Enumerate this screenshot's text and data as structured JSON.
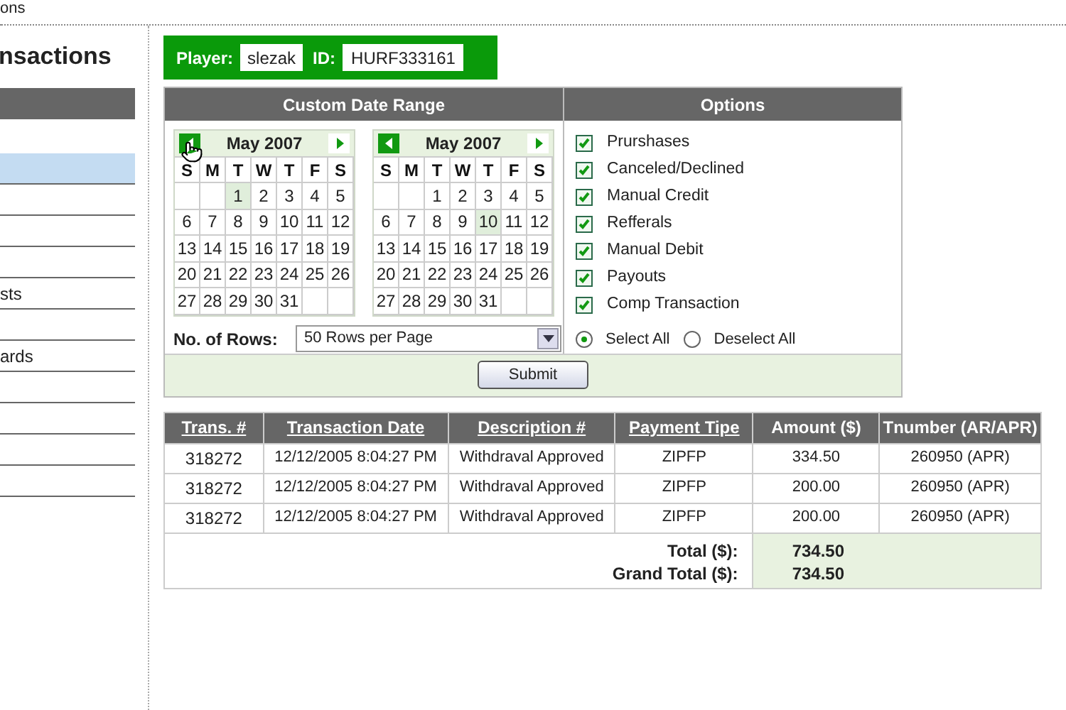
{
  "breadcrumb": "ons",
  "page_title": "nsactions",
  "sidebar": {
    "items": [
      {
        "selected": true
      },
      {
        "selected": false
      },
      {
        "selected": false
      },
      {
        "selected": false
      },
      {
        "selected": false,
        "label": "sts"
      },
      {
        "selected": false
      },
      {
        "selected": false,
        "label": "ards"
      },
      {
        "selected": false
      },
      {
        "selected": false
      },
      {
        "selected": false
      },
      {
        "selected": false
      }
    ]
  },
  "player": {
    "label": "Player:",
    "value": "slezak",
    "id_label": "ID:",
    "id_value": "HURF333161"
  },
  "date_range": {
    "title": "Custom Date Range",
    "calendars": [
      {
        "month": "May 2007",
        "weekdays": [
          "S",
          "M",
          "T",
          "W",
          "T",
          "F",
          "S"
        ],
        "days": [
          {
            "day": "1",
            "selected": true
          },
          {
            "day": "2",
            "selected": false
          },
          {
            "day": "3",
            "selected": false
          },
          {
            "day": "4",
            "selected": false
          },
          {
            "day": "5",
            "selected": false
          },
          {
            "day": "6",
            "selected": false
          },
          {
            "day": "7",
            "selected": false
          },
          {
            "day": "8",
            "selected": false
          },
          {
            "day": "9",
            "selected": false
          },
          {
            "day": "10",
            "selected": false
          },
          {
            "day": "11",
            "selected": false
          },
          {
            "day": "12",
            "selected": false
          },
          {
            "day": "13",
            "selected": false
          },
          {
            "day": "14",
            "selected": false
          },
          {
            "day": "15",
            "selected": false
          },
          {
            "day": "16",
            "selected": false
          },
          {
            "day": "17",
            "selected": false
          },
          {
            "day": "18",
            "selected": false
          },
          {
            "day": "19",
            "selected": false
          },
          {
            "day": "20",
            "selected": false
          },
          {
            "day": "21",
            "selected": false
          },
          {
            "day": "22",
            "selected": false
          },
          {
            "day": "23",
            "selected": false
          },
          {
            "day": "24",
            "selected": false
          },
          {
            "day": "25",
            "selected": false
          },
          {
            "day": "26",
            "selected": false
          },
          {
            "day": "27",
            "selected": false
          },
          {
            "day": "28",
            "selected": false
          },
          {
            "day": "29",
            "selected": false
          },
          {
            "day": "30",
            "selected": false
          },
          {
            "day": "31",
            "selected": false
          }
        ]
      },
      {
        "month": "May 2007",
        "weekdays": [
          "S",
          "M",
          "T",
          "W",
          "T",
          "F",
          "S"
        ],
        "days": [
          {
            "day": "1",
            "selected": false
          },
          {
            "day": "2",
            "selected": false
          },
          {
            "day": "3",
            "selected": false
          },
          {
            "day": "4",
            "selected": false
          },
          {
            "day": "5",
            "selected": false
          },
          {
            "day": "6",
            "selected": false
          },
          {
            "day": "7",
            "selected": false
          },
          {
            "day": "8",
            "selected": false
          },
          {
            "day": "9",
            "selected": false
          },
          {
            "day": "10",
            "selected": true
          },
          {
            "day": "11",
            "selected": false
          },
          {
            "day": "12",
            "selected": false
          },
          {
            "day": "13",
            "selected": false
          },
          {
            "day": "14",
            "selected": false
          },
          {
            "day": "15",
            "selected": false
          },
          {
            "day": "16",
            "selected": false
          },
          {
            "day": "17",
            "selected": false
          },
          {
            "day": "18",
            "selected": false
          },
          {
            "day": "19",
            "selected": false
          },
          {
            "day": "20",
            "selected": false
          },
          {
            "day": "21",
            "selected": false
          },
          {
            "day": "22",
            "selected": false
          },
          {
            "day": "23",
            "selected": false
          },
          {
            "day": "24",
            "selected": false
          },
          {
            "day": "25",
            "selected": false
          },
          {
            "day": "26",
            "selected": false
          },
          {
            "day": "27",
            "selected": false
          },
          {
            "day": "28",
            "selected": false
          },
          {
            "day": "29",
            "selected": false
          },
          {
            "day": "30",
            "selected": false
          },
          {
            "day": "31",
            "selected": false
          }
        ]
      }
    ],
    "rows_label": "No. of Rows:",
    "rows_value": "50 Rows per Page"
  },
  "options": {
    "title": "Options",
    "items": [
      {
        "label": "Prurshases",
        "checked": true
      },
      {
        "label": "Canceled/Declined",
        "checked": true
      },
      {
        "label": "Manual Credit",
        "checked": true
      },
      {
        "label": "Refferals",
        "checked": true
      },
      {
        "label": "Manual Debit",
        "checked": true
      },
      {
        "label": "Payouts",
        "checked": true
      },
      {
        "label": "Comp Transaction",
        "checked": true
      }
    ],
    "radios": [
      {
        "label": "Select All",
        "selected": true
      },
      {
        "label": "Deselect All",
        "selected": false
      }
    ]
  },
  "submit": "Submit",
  "table": {
    "columns": [
      {
        "label": "Trans. #",
        "kind": "link"
      },
      {
        "label": "Transaction Date",
        "kind": "link"
      },
      {
        "label": "Description #",
        "kind": "link"
      },
      {
        "label": "Payment Tipe",
        "kind": "link"
      },
      {
        "label": "Amount ($)",
        "kind": "plain"
      },
      {
        "label": "Tnumber (AR/APR)",
        "kind": "plain"
      }
    ],
    "rows": [
      [
        "318272",
        "12/12/2005 8:04:27 PM",
        "Withdraval Approved",
        "ZIPFP",
        "334.50",
        "260950 (APR)"
      ],
      [
        "318272",
        "12/12/2005 8:04:27 PM",
        "Withdraval Approved",
        "ZIPFP",
        "200.00",
        "260950 (APR)"
      ],
      [
        "318272",
        "12/12/2005 8:04:27 PM",
        "Withdraval Approved",
        "ZIPFP",
        "200.00",
        "260950 (APR)"
      ]
    ],
    "totals": [
      {
        "label": "Total ($):",
        "value": "734.50"
      },
      {
        "label": "Grand Total ($):",
        "value": "734.50"
      }
    ]
  }
}
